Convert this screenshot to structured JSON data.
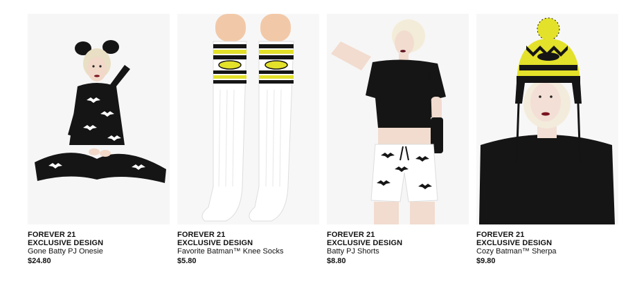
{
  "products": [
    {
      "brand_line1": "FOREVER 21",
      "brand_line2": "EXCLUSIVE DESIGN",
      "name": "Gone Batty PJ Onesie",
      "price": "$24.80",
      "image_icon": "onesie-photo"
    },
    {
      "brand_line1": "FOREVER 21",
      "brand_line2": "EXCLUSIVE DESIGN",
      "name": "Favorite Batman™ Knee Socks",
      "price": "$5.80",
      "image_icon": "socks-photo"
    },
    {
      "brand_line1": "FOREVER 21",
      "brand_line2": "EXCLUSIVE DESIGN",
      "name": "Batty PJ Shorts",
      "price": "$8.80",
      "image_icon": "shorts-photo"
    },
    {
      "brand_line1": "FOREVER 21",
      "brand_line2": "EXCLUSIVE DESIGN",
      "name": "Cozy Batman™ Sherpa",
      "price": "$9.80",
      "image_icon": "beanie-photo"
    }
  ],
  "colors": {
    "text": "#111111",
    "batman_yellow": "#e3e12a",
    "garment_black": "#151515",
    "photo_bg": "#f4f4f4"
  }
}
